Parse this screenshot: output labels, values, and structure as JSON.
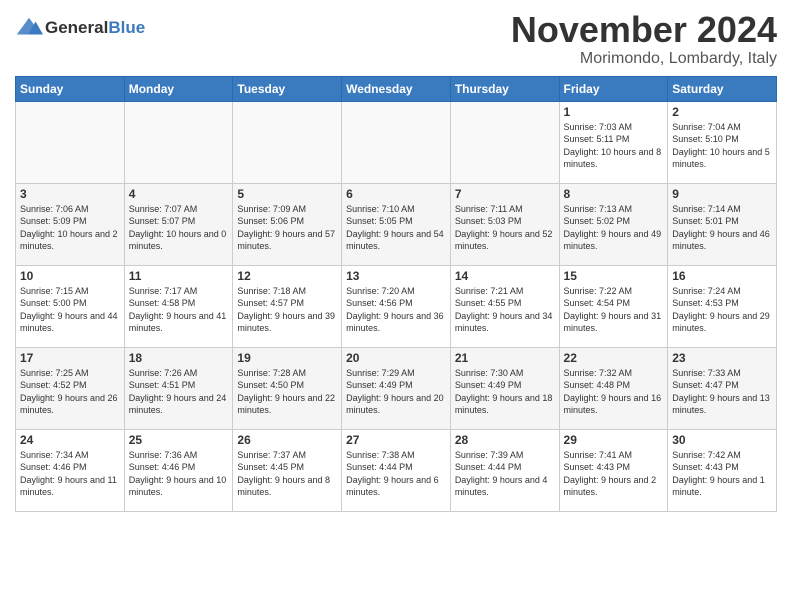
{
  "header": {
    "logo_line1": "General",
    "logo_line2": "Blue",
    "month_title": "November 2024",
    "location": "Morimondo, Lombardy, Italy"
  },
  "weekdays": [
    "Sunday",
    "Monday",
    "Tuesday",
    "Wednesday",
    "Thursday",
    "Friday",
    "Saturday"
  ],
  "weeks": [
    [
      {
        "day": "",
        "info": ""
      },
      {
        "day": "",
        "info": ""
      },
      {
        "day": "",
        "info": ""
      },
      {
        "day": "",
        "info": ""
      },
      {
        "day": "",
        "info": ""
      },
      {
        "day": "1",
        "info": "Sunrise: 7:03 AM\nSunset: 5:11 PM\nDaylight: 10 hours and 8 minutes."
      },
      {
        "day": "2",
        "info": "Sunrise: 7:04 AM\nSunset: 5:10 PM\nDaylight: 10 hours and 5 minutes."
      }
    ],
    [
      {
        "day": "3",
        "info": "Sunrise: 7:06 AM\nSunset: 5:09 PM\nDaylight: 10 hours and 2 minutes."
      },
      {
        "day": "4",
        "info": "Sunrise: 7:07 AM\nSunset: 5:07 PM\nDaylight: 10 hours and 0 minutes."
      },
      {
        "day": "5",
        "info": "Sunrise: 7:09 AM\nSunset: 5:06 PM\nDaylight: 9 hours and 57 minutes."
      },
      {
        "day": "6",
        "info": "Sunrise: 7:10 AM\nSunset: 5:05 PM\nDaylight: 9 hours and 54 minutes."
      },
      {
        "day": "7",
        "info": "Sunrise: 7:11 AM\nSunset: 5:03 PM\nDaylight: 9 hours and 52 minutes."
      },
      {
        "day": "8",
        "info": "Sunrise: 7:13 AM\nSunset: 5:02 PM\nDaylight: 9 hours and 49 minutes."
      },
      {
        "day": "9",
        "info": "Sunrise: 7:14 AM\nSunset: 5:01 PM\nDaylight: 9 hours and 46 minutes."
      }
    ],
    [
      {
        "day": "10",
        "info": "Sunrise: 7:15 AM\nSunset: 5:00 PM\nDaylight: 9 hours and 44 minutes."
      },
      {
        "day": "11",
        "info": "Sunrise: 7:17 AM\nSunset: 4:58 PM\nDaylight: 9 hours and 41 minutes."
      },
      {
        "day": "12",
        "info": "Sunrise: 7:18 AM\nSunset: 4:57 PM\nDaylight: 9 hours and 39 minutes."
      },
      {
        "day": "13",
        "info": "Sunrise: 7:20 AM\nSunset: 4:56 PM\nDaylight: 9 hours and 36 minutes."
      },
      {
        "day": "14",
        "info": "Sunrise: 7:21 AM\nSunset: 4:55 PM\nDaylight: 9 hours and 34 minutes."
      },
      {
        "day": "15",
        "info": "Sunrise: 7:22 AM\nSunset: 4:54 PM\nDaylight: 9 hours and 31 minutes."
      },
      {
        "day": "16",
        "info": "Sunrise: 7:24 AM\nSunset: 4:53 PM\nDaylight: 9 hours and 29 minutes."
      }
    ],
    [
      {
        "day": "17",
        "info": "Sunrise: 7:25 AM\nSunset: 4:52 PM\nDaylight: 9 hours and 26 minutes."
      },
      {
        "day": "18",
        "info": "Sunrise: 7:26 AM\nSunset: 4:51 PM\nDaylight: 9 hours and 24 minutes."
      },
      {
        "day": "19",
        "info": "Sunrise: 7:28 AM\nSunset: 4:50 PM\nDaylight: 9 hours and 22 minutes."
      },
      {
        "day": "20",
        "info": "Sunrise: 7:29 AM\nSunset: 4:49 PM\nDaylight: 9 hours and 20 minutes."
      },
      {
        "day": "21",
        "info": "Sunrise: 7:30 AM\nSunset: 4:49 PM\nDaylight: 9 hours and 18 minutes."
      },
      {
        "day": "22",
        "info": "Sunrise: 7:32 AM\nSunset: 4:48 PM\nDaylight: 9 hours and 16 minutes."
      },
      {
        "day": "23",
        "info": "Sunrise: 7:33 AM\nSunset: 4:47 PM\nDaylight: 9 hours and 13 minutes."
      }
    ],
    [
      {
        "day": "24",
        "info": "Sunrise: 7:34 AM\nSunset: 4:46 PM\nDaylight: 9 hours and 11 minutes."
      },
      {
        "day": "25",
        "info": "Sunrise: 7:36 AM\nSunset: 4:46 PM\nDaylight: 9 hours and 10 minutes."
      },
      {
        "day": "26",
        "info": "Sunrise: 7:37 AM\nSunset: 4:45 PM\nDaylight: 9 hours and 8 minutes."
      },
      {
        "day": "27",
        "info": "Sunrise: 7:38 AM\nSunset: 4:44 PM\nDaylight: 9 hours and 6 minutes."
      },
      {
        "day": "28",
        "info": "Sunrise: 7:39 AM\nSunset: 4:44 PM\nDaylight: 9 hours and 4 minutes."
      },
      {
        "day": "29",
        "info": "Sunrise: 7:41 AM\nSunset: 4:43 PM\nDaylight: 9 hours and 2 minutes."
      },
      {
        "day": "30",
        "info": "Sunrise: 7:42 AM\nSunset: 4:43 PM\nDaylight: 9 hours and 1 minute."
      }
    ]
  ]
}
